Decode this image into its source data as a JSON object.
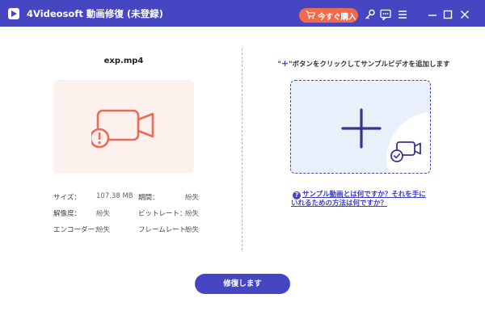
{
  "titlebar": {
    "app_title": "4Videosoft 動画修復 (未登録)",
    "buy_label": "今すぐ購入",
    "colors": {
      "bar": "#4646c2",
      "buy": "#f16a4a"
    }
  },
  "left_panel": {
    "file_name": "exp.mp4",
    "info": {
      "size_label": "サイズ：",
      "size_value": "107.38 MB",
      "duration_label": "期間：",
      "duration_value": "紛失",
      "resolution_label": "解像度：",
      "resolution_value": "紛失",
      "bitrate_label": "ビットレート：",
      "bitrate_value": "紛失",
      "encoder_label": "エンコーダー：",
      "encoder_value": "紛失",
      "framerate_label": "フレームレート：",
      "framerate_value": "紛失"
    }
  },
  "right_panel": {
    "hint_prefix": "\"",
    "hint_plus": "+",
    "hint_suffix": "\"ボタンをクリックしてサンプルビデオを追加します",
    "help_link": "サンプル動画とは何ですか？それを手にいれるための方法は何ですか？"
  },
  "actions": {
    "repair_label": "修復します"
  },
  "icons": {
    "logo": "app-logo-icon",
    "cart": "cart-icon",
    "key": "key-icon",
    "chat": "chat-icon",
    "menu": "menu-icon",
    "minimize": "minimize-icon",
    "maximize": "maximize-icon",
    "close": "close-icon",
    "broken_video": "broken-video-icon",
    "plus": "plus-icon",
    "video_check": "video-check-icon",
    "help": "help-icon"
  }
}
